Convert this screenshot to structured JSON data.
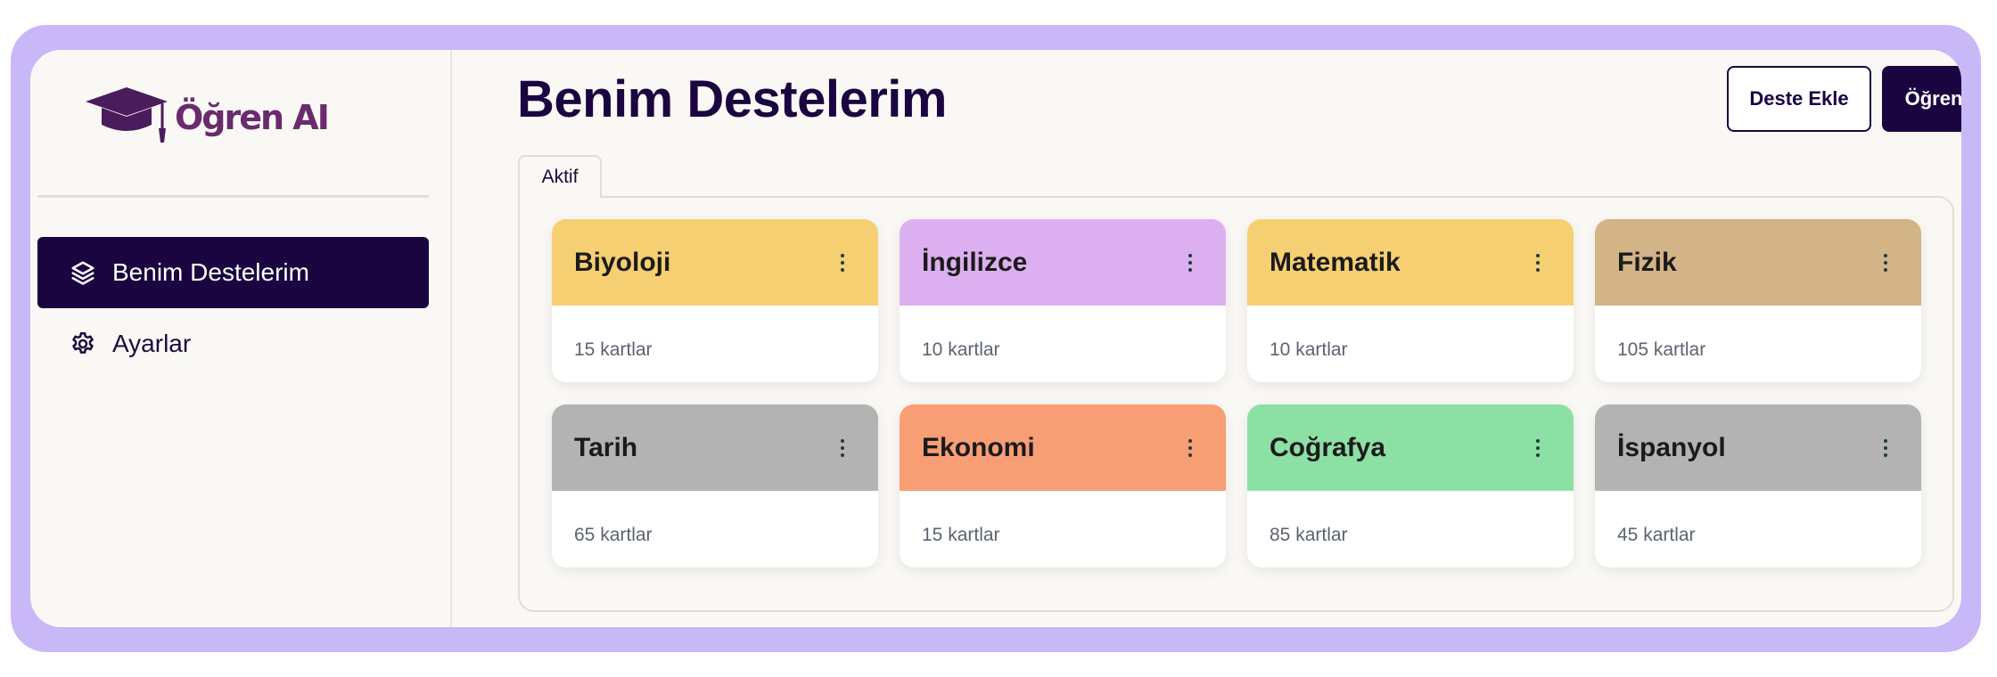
{
  "brand": {
    "name": "Öğren AI"
  },
  "sidebar": {
    "items": [
      {
        "label": "Benim Destelerim",
        "icon": "layers-icon",
        "active": true
      },
      {
        "label": "Ayarlar",
        "icon": "gear-icon",
        "active": false
      }
    ]
  },
  "header": {
    "title": "Benim Destelerim",
    "add_deck_label": "Deste Ekle",
    "learn_label": "Öğren"
  },
  "tabs": [
    {
      "label": "Aktif",
      "active": true
    }
  ],
  "decks": [
    {
      "name": "Biyoloji",
      "count": "15 kartlar",
      "color": "#f5cf72"
    },
    {
      "name": "İngilizce",
      "count": "10 kartlar",
      "color": "#dcb0f0"
    },
    {
      "name": "Matematik",
      "count": "10 kartlar",
      "color": "#f5cf72"
    },
    {
      "name": "Fizik",
      "count": "105 kartlar",
      "color": "#d2b486"
    },
    {
      "name": "Tarih",
      "count": "65 kartlar",
      "color": "#b3b3b3"
    },
    {
      "name": "Ekonomi",
      "count": "15 kartlar",
      "color": "#f89e74"
    },
    {
      "name": "Coğrafya",
      "count": "85 kartlar",
      "color": "#8ce0a4"
    },
    {
      "name": "İspanyol",
      "count": "45 kartlar",
      "color": "#b3b3b3"
    }
  ],
  "colors": {
    "frame": "#c9b8f7",
    "primary": "#1a0540",
    "background": "#faf8f5",
    "brand": "#6a2b6e"
  }
}
